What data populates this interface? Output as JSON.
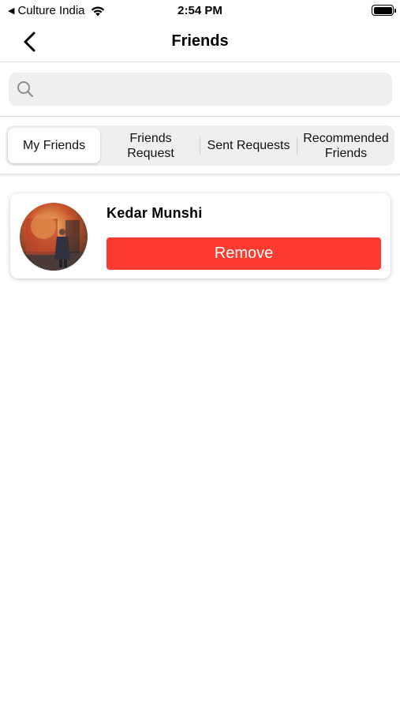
{
  "status_bar": {
    "back_app": "Culture India",
    "time": "2:54 PM"
  },
  "nav": {
    "title": "Friends"
  },
  "search": {
    "value": "",
    "placeholder": ""
  },
  "tabs": [
    {
      "label": "My Friends",
      "active": true
    },
    {
      "label": "Friends Request",
      "active": false
    },
    {
      "label": "Sent Requests",
      "active": false
    },
    {
      "label": "Recommended Friends",
      "active": false
    }
  ],
  "friends": [
    {
      "name": "Kedar Munshi",
      "action_label": "Remove"
    }
  ],
  "colors": {
    "remove": "#ff3b30",
    "segment_bg": "#efefef"
  }
}
